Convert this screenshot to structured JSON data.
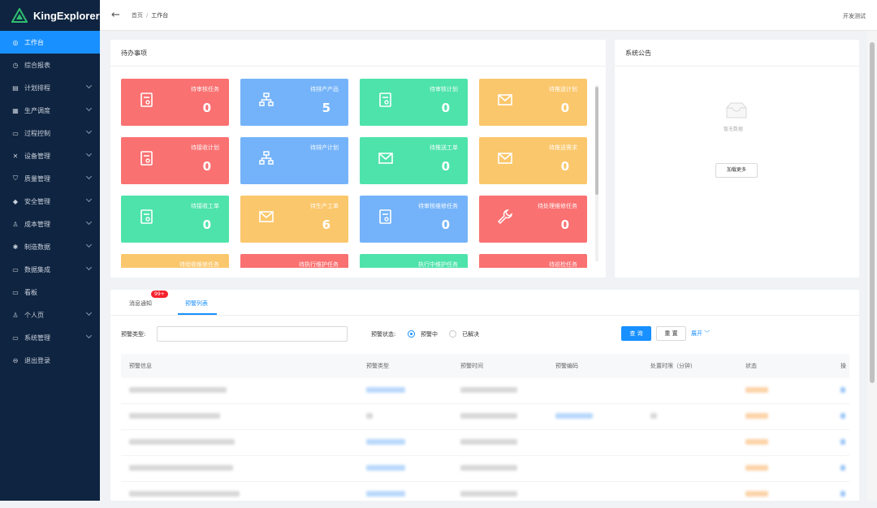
{
  "app": {
    "name": "KingExplorer"
  },
  "sidebar": {
    "items": [
      {
        "label": "工作台",
        "icon": "dashboard-icon",
        "active": true,
        "arrow": false
      },
      {
        "label": "综合报表",
        "icon": "report-icon",
        "active": false,
        "arrow": false
      },
      {
        "label": "计划排程",
        "icon": "schedule-icon",
        "active": false,
        "arrow": true
      },
      {
        "label": "生产调度",
        "icon": "dispatch-icon",
        "active": false,
        "arrow": true
      },
      {
        "label": "过程控制",
        "icon": "process-icon",
        "active": false,
        "arrow": true
      },
      {
        "label": "设备管理",
        "icon": "tools-icon",
        "active": false,
        "arrow": true
      },
      {
        "label": "质量管理",
        "icon": "shield-icon",
        "active": false,
        "arrow": true
      },
      {
        "label": "安全管理",
        "icon": "safety-icon",
        "active": false,
        "arrow": true
      },
      {
        "label": "成本管理",
        "icon": "person-icon",
        "active": false,
        "arrow": true
      },
      {
        "label": "制造数据",
        "icon": "data-icon",
        "active": false,
        "arrow": true
      },
      {
        "label": "数据集成",
        "icon": "monitor-icon",
        "active": false,
        "arrow": true
      },
      {
        "label": "看板",
        "icon": "board-icon",
        "active": false,
        "arrow": false
      },
      {
        "label": "个人页",
        "icon": "person-icon",
        "active": false,
        "arrow": true
      },
      {
        "label": "系统管理",
        "icon": "monitor-icon",
        "active": false,
        "arrow": true
      },
      {
        "label": "退出登录",
        "icon": "logout-icon",
        "active": false,
        "arrow": false
      }
    ]
  },
  "topbar": {
    "breadcrumb_home": "首页",
    "breadcrumb_sep": "/",
    "breadcrumb_current": "工作台",
    "user": "开发测试"
  },
  "todo": {
    "title": "待办事项",
    "tiles": [
      {
        "name": "待审核任务",
        "value": "0",
        "color": "#fa7171",
        "icon": "document-icon"
      },
      {
        "name": "待排产产品",
        "value": "5",
        "color": "#74b3f9",
        "icon": "hierarchy-icon"
      },
      {
        "name": "待审核计划",
        "value": "0",
        "color": "#4ee3ab",
        "icon": "document-icon"
      },
      {
        "name": "待推送计划",
        "value": "0",
        "color": "#fbc76c",
        "icon": "mail-icon"
      },
      {
        "name": "待接收计划",
        "value": "0",
        "color": "#fa7171",
        "icon": "document-icon"
      },
      {
        "name": "待排产计划",
        "value": "",
        "color": "#74b3f9",
        "icon": "hierarchy-icon"
      },
      {
        "name": "待推送工单",
        "value": "0",
        "color": "#4ee3ab",
        "icon": "mail-icon"
      },
      {
        "name": "待推送需求",
        "value": "0",
        "color": "#fbc76c",
        "icon": "mail-icon"
      },
      {
        "name": "待接收工单",
        "value": "0",
        "color": "#4ee3ab",
        "icon": "document-icon"
      },
      {
        "name": "待生产工单",
        "value": "6",
        "color": "#fbc76c",
        "icon": "mail-icon"
      },
      {
        "name": "待审核维修任务",
        "value": "0",
        "color": "#74b3f9",
        "icon": "document-icon"
      },
      {
        "name": "待处理维修任务",
        "value": "0",
        "color": "#fa7171",
        "icon": "wrench-icon"
      },
      {
        "name": "待验收维修任务",
        "value": "",
        "color": "#fbc76c",
        "icon": "document-icon"
      },
      {
        "name": "待执行维护任务",
        "value": "",
        "color": "#fa7171",
        "icon": "document-icon"
      },
      {
        "name": "执行中维护任务",
        "value": "",
        "color": "#4ee3ab",
        "icon": "document-icon"
      },
      {
        "name": "待巡检任务",
        "value": "",
        "color": "#fa7171",
        "icon": "document-icon"
      }
    ]
  },
  "notice": {
    "title": "系统公告",
    "empty_text": "暂无数据",
    "load_more": "加载更多"
  },
  "alerts": {
    "tabs": [
      "消息通知",
      "预警列表"
    ],
    "badge": "99+",
    "filter": {
      "type_label": "预警类型:",
      "status_label": "预警状态:",
      "status_options": [
        "预警中",
        "已解决"
      ],
      "query": "查 询",
      "reset": "重 置",
      "expand": "展开"
    },
    "columns": [
      "预警信息",
      "预警类型",
      "预警时间",
      "预警编码",
      "处置时限（分钟）",
      "状态",
      "操"
    ],
    "row_count": 5
  }
}
